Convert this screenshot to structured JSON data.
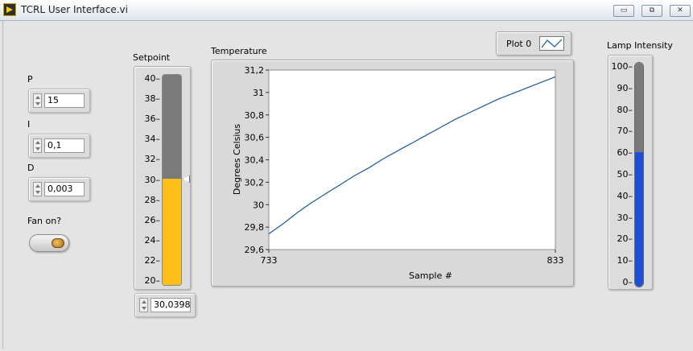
{
  "window": {
    "title": "TCRL User Interface.vi",
    "minimize_icon": "minimize-icon",
    "restore_icon": "restore-icon",
    "close_icon": "close-icon"
  },
  "pid": {
    "p": {
      "label": "P",
      "value": "15"
    },
    "i": {
      "label": "I",
      "value": "0,1"
    },
    "d": {
      "label": "D",
      "value": "0,003"
    }
  },
  "fan": {
    "label": "Fan on?"
  },
  "setpoint": {
    "label": "Setpoint",
    "scale": [
      "40",
      "38",
      "36",
      "34",
      "32",
      "30",
      "28",
      "26",
      "24",
      "22",
      "20"
    ],
    "range": [
      20,
      40
    ],
    "level": 30.0398,
    "value": "30,0398",
    "fill_color": "#ffbf1a",
    "empty_color": "#7a7a7a"
  },
  "lamp": {
    "label": "Lamp Intensity",
    "scale": [
      "100",
      "90",
      "80",
      "70",
      "60",
      "50",
      "40",
      "30",
      "20",
      "10",
      "0"
    ],
    "range": [
      0,
      100
    ],
    "level": 60,
    "fill_color": "#1f4fd8",
    "empty_color": "#7a7a7a"
  },
  "legend": {
    "label": "Plot 0"
  },
  "chart_data": {
    "type": "line",
    "title": "Temperature",
    "xlabel": "Sample #",
    "ylabel": "Degrees Celsius",
    "xlim": [
      733,
      833
    ],
    "ylim": [
      29.6,
      31.2
    ],
    "x_ticks": [
      "733",
      "833"
    ],
    "y_ticks": [
      "31,2",
      "31",
      "30,8",
      "30,6",
      "30,4",
      "30,2",
      "30",
      "29,8",
      "29,6"
    ],
    "grid": false,
    "series": [
      {
        "name": "Plot 0",
        "color": "#1a5a9a",
        "x": [
          733,
          738,
          743,
          748,
          753,
          758,
          763,
          768,
          773,
          778,
          783,
          788,
          793,
          798,
          803,
          808,
          813,
          818,
          823,
          828,
          833
        ],
        "y": [
          29.74,
          29.83,
          29.93,
          30.02,
          30.1,
          30.18,
          30.26,
          30.33,
          30.41,
          30.48,
          30.55,
          30.62,
          30.69,
          30.76,
          30.82,
          30.88,
          30.94,
          30.99,
          31.04,
          31.09,
          31.14
        ]
      }
    ]
  }
}
